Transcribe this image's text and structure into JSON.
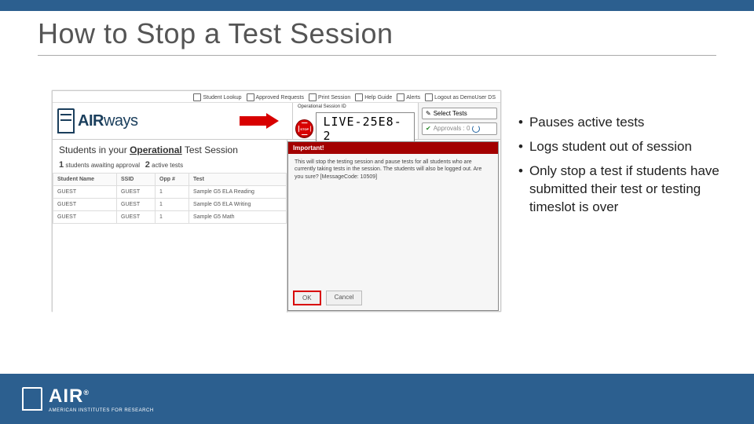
{
  "title": "How to Stop a Test Session",
  "app": {
    "toolbar": {
      "studentLookup": "Student Lookup",
      "approvedRequests": "Approved Requests",
      "printSession": "Print Session",
      "helpGuide": "Help Guide",
      "alerts": "Alerts",
      "logout": "Logout as DemoUser DS"
    },
    "logoPrimary": "AIR",
    "logoSecondary": "ways",
    "sessionLabel": "Operational Session ID",
    "stopLabel": "STOP",
    "sessionId": "LIVE-25E8-2",
    "selectTests": "Select Tests",
    "approvals": "Approvals : 0",
    "panelTitlePre": "Students in your ",
    "panelTitleOp": "Operational",
    "panelTitlePost": " Test Session",
    "countAwaiting": "1",
    "countAwaitingLabel": "students awaiting approval",
    "countActive": "2",
    "countActiveLabel": "active tests",
    "table": {
      "headers": {
        "name": "Student Name",
        "ssid": "SSID",
        "opp": "Opp #",
        "test": "Test"
      },
      "rows": [
        {
          "name": "GUEST",
          "ssid": "GUEST",
          "opp": "1",
          "test": "Sample G5 ELA Reading"
        },
        {
          "name": "GUEST",
          "ssid": "GUEST",
          "opp": "1",
          "test": "Sample G5 ELA Writing"
        },
        {
          "name": "GUEST",
          "ssid": "GUEST",
          "opp": "1",
          "test": "Sample G5 Math"
        }
      ]
    },
    "modal": {
      "header": "Important!",
      "body": "This will stop the testing session and pause tests for all students who are currently taking tests in the session. The students will also be logged out. Are you sure? [MessageCode: 10509]",
      "ok": "OK",
      "cancel": "Cancel"
    }
  },
  "bullets": [
    "Pauses active tests",
    "Logs student out of session",
    "Only stop a test if students have submitted their test or testing timeslot is over"
  ],
  "footer": {
    "brand": "AIR",
    "tagline": "AMERICAN INSTITUTES FOR RESEARCH"
  }
}
